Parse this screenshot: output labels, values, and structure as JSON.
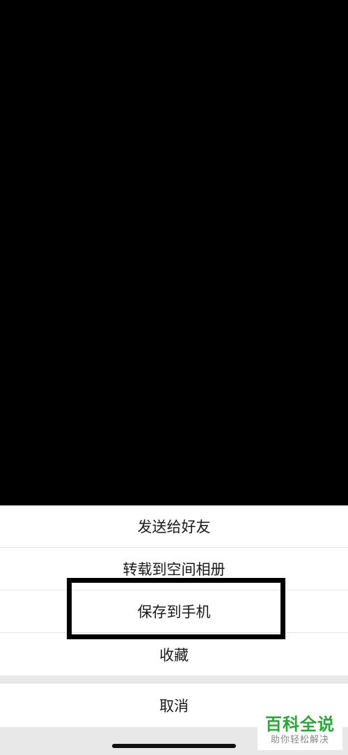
{
  "menu": {
    "items": [
      {
        "label": "发送给好友"
      },
      {
        "label": "转载到空间相册"
      },
      {
        "label": "保存到手机"
      },
      {
        "label": "收藏"
      }
    ],
    "cancel_label": "取消"
  },
  "watermark": {
    "title": "百科全说",
    "subtitle": "助你轻松解决"
  },
  "colors": {
    "background": "#000000",
    "sheet": "#ffffff",
    "separator": "#e8e8e8",
    "watermark_green": "#27a836"
  }
}
